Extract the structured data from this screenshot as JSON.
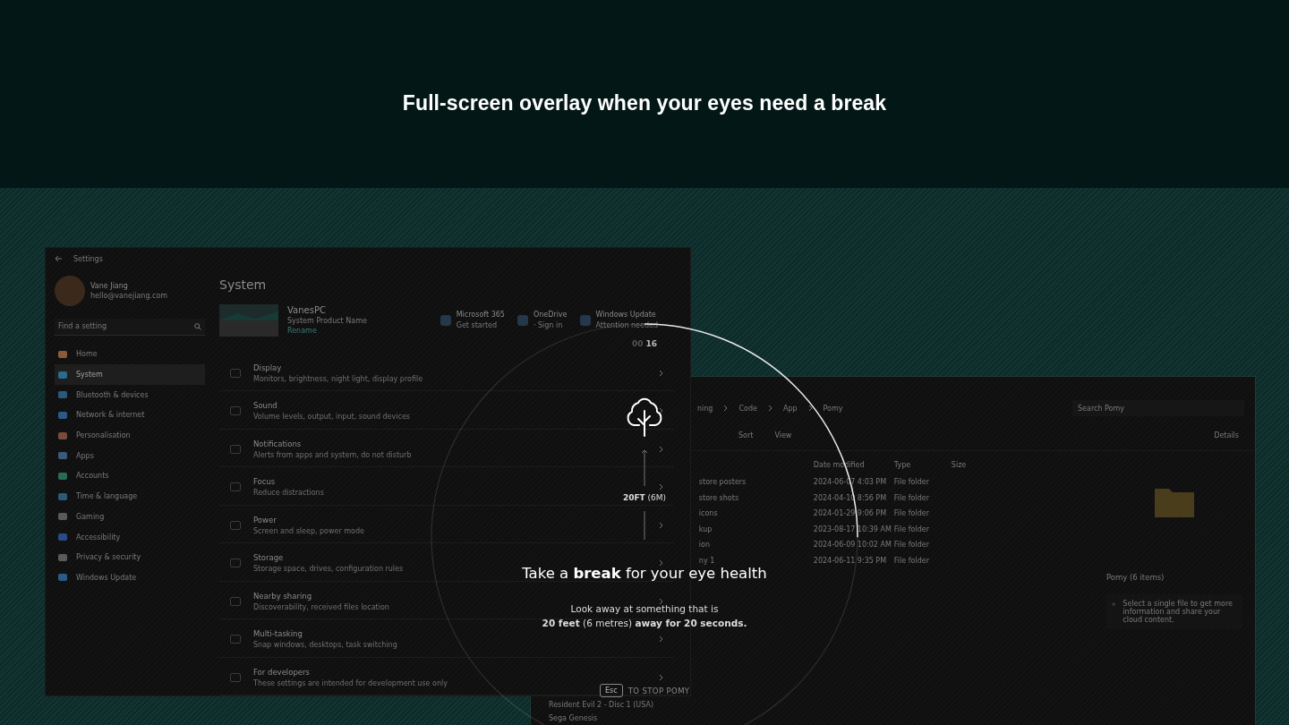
{
  "header": {
    "title": "Full-screen overlay when your eyes need a break"
  },
  "settings": {
    "title": "Settings",
    "user": {
      "name": "Vane Jiang",
      "email": "hello@vanejiang.com"
    },
    "search": {
      "placeholder": "Find a setting"
    },
    "nav": [
      {
        "label": "Home",
        "selected": false,
        "color": "#8a5a3a"
      },
      {
        "label": "System",
        "selected": true,
        "color": "#2a6a8a"
      },
      {
        "label": "Bluetooth & devices",
        "selected": false,
        "color": "#2a5a7a"
      },
      {
        "label": "Network & internet",
        "selected": false,
        "color": "#2a5a8a"
      },
      {
        "label": "Personalisation",
        "selected": false,
        "color": "#7a4a3a"
      },
      {
        "label": "Apps",
        "selected": false,
        "color": "#3a5a7a"
      },
      {
        "label": "Accounts",
        "selected": false,
        "color": "#2a6a5a"
      },
      {
        "label": "Time & language",
        "selected": false,
        "color": "#2a5a7a"
      },
      {
        "label": "Gaming",
        "selected": false,
        "color": "#5a5a5a"
      },
      {
        "label": "Accessibility",
        "selected": false,
        "color": "#2a4a8a"
      },
      {
        "label": "Privacy & security",
        "selected": false,
        "color": "#5a5a5a"
      },
      {
        "label": "Windows Update",
        "selected": false,
        "color": "#2a5a8a"
      }
    ],
    "heading": "System",
    "device": {
      "name": "VanesPC",
      "model": "System Product Name",
      "action": "Rename"
    },
    "tiles": [
      {
        "title": "Microsoft 365",
        "subtitle": "Get started"
      },
      {
        "title": "OneDrive",
        "subtitle": "· Sign in"
      },
      {
        "title": "Windows Update",
        "subtitle": "Attention needed"
      }
    ],
    "rows": [
      {
        "title": "Display",
        "subtitle": "Monitors, brightness, night light, display profile"
      },
      {
        "title": "Sound",
        "subtitle": "Volume levels, output, input, sound devices"
      },
      {
        "title": "Notifications",
        "subtitle": "Alerts from apps and system, do not disturb"
      },
      {
        "title": "Focus",
        "subtitle": "Reduce distractions"
      },
      {
        "title": "Power",
        "subtitle": "Screen and sleep, power mode"
      },
      {
        "title": "Storage",
        "subtitle": "Storage space, drives, configuration rules"
      },
      {
        "title": "Nearby sharing",
        "subtitle": "Discoverability, received files location"
      },
      {
        "title": "Multi-tasking",
        "subtitle": "Snap windows, desktops, task switching"
      },
      {
        "title": "For developers",
        "subtitle": "These settings are intended for development use only"
      }
    ]
  },
  "explorer": {
    "breadcrumbs": [
      "ning",
      "Code",
      "App",
      "Pomy"
    ],
    "search": {
      "placeholder": "Search Pomy"
    },
    "toolbar": [
      "Sort",
      "View",
      "Details"
    ],
    "columns": [
      "Date modified",
      "Type",
      "Size"
    ],
    "rows": [
      {
        "name": "store posters",
        "date": "2024-06-07 4:03 PM",
        "type": "File folder"
      },
      {
        "name": "store shots",
        "date": "2024-04-10 8:56 PM",
        "type": "File folder"
      },
      {
        "name": "icons",
        "date": "2024-01-29 9:06 PM",
        "type": "File folder"
      },
      {
        "name": "kup",
        "date": "2023-08-17 10:39 AM",
        "type": "File folder"
      },
      {
        "name": "ion",
        "date": "2024-06-09 10:02 AM",
        "type": "File folder"
      },
      {
        "name": "ny 1",
        "date": "2024-06-11 9:35 PM",
        "type": "File folder"
      }
    ],
    "nav": [
      "Resident Evil 2 - Disc 1 (USA)",
      "Sega Genesis"
    ],
    "details": {
      "title": "Pomy (6 items)",
      "text": "Select a single file to get more information and share your cloud content."
    }
  },
  "overlay": {
    "minutes": "00",
    "seconds": "16",
    "level": 0.25,
    "distance": "**20FT** (6M)",
    "headline": "Take a **break** for your eye health",
    "body": [
      "Look away at something that is",
      "**20 feet** (6 metres) **away for 20 seconds.**"
    ],
    "key": "Esc",
    "hint": "TO STOP POMY"
  }
}
